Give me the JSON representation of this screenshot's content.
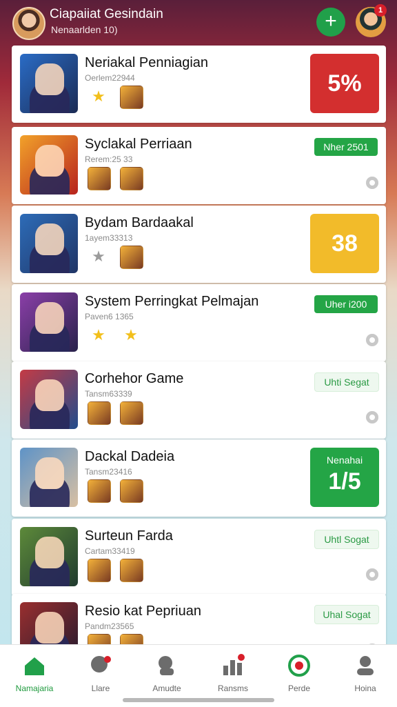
{
  "header": {
    "title": "Ciapaiiat Gesindain",
    "subtitle": "Nenaarlden 10)",
    "profile_badge": "1",
    "accent": "#21a04a"
  },
  "cards": [
    {
      "name": "Neriakal Penniagian",
      "meta": "Oerlem22944",
      "icon1": "star-gold",
      "icon2": "game-thumb",
      "right_type": "big",
      "right_value": "5%",
      "right_label": "",
      "right_color": "red",
      "c1": "#2a6cc6",
      "c2": "#1b2b54"
    },
    {
      "name": "Syclakal Perriaan",
      "meta": "Rerem:25 33",
      "icon1": "game-thumb",
      "icon2": "game-thumb",
      "right_type": "pill",
      "right_value": "Nher 2501",
      "right_label": "",
      "right_color": "green-solid",
      "c1": "#f2a22a",
      "c2": "#b7231d"
    },
    {
      "name": "Bydam Bardaakal",
      "meta": "1ayem33313",
      "icon1": "star-grey",
      "icon2": "game-thumb",
      "right_type": "big",
      "right_value": "38",
      "right_label": "",
      "right_color": "yellow",
      "c1": "#2d6cb8",
      "c2": "#203566"
    },
    {
      "name": "System Perringkat Pelmajan",
      "meta": "Paven6 1365",
      "icon1": "star-gold",
      "icon2": "star-gold",
      "right_type": "pill",
      "right_value": "Uher i200",
      "right_label": "",
      "right_color": "green-solid",
      "c1": "#8b3fa8",
      "c2": "#29224b"
    },
    {
      "name": "Corhehor Game",
      "meta": "Tansm63339",
      "icon1": "game-thumb",
      "icon2": "game-thumb",
      "right_type": "pill",
      "right_value": "Uhti Segat",
      "right_label": "",
      "right_color": "green-soft",
      "c1": "#c43b45",
      "c2": "#214c8c"
    },
    {
      "name": "Dackal Dadeia",
      "meta": "Tansm23416",
      "icon1": "game-thumb",
      "icon2": "game-thumb",
      "right_type": "big",
      "right_value": "1/5",
      "right_label": "Nenahai",
      "right_color": "green",
      "c1": "#5e93c7",
      "c2": "#d8c0a3"
    },
    {
      "name": "Surteun Farda",
      "meta": "Cartam33419",
      "icon1": "game-thumb",
      "icon2": "game-thumb",
      "right_type": "pill",
      "right_value": "Uhtl Sogat",
      "right_label": "",
      "right_color": "green-soft",
      "c1": "#5d8a3a",
      "c2": "#203b2f"
    },
    {
      "name": "Resio kat Pepriuan",
      "meta": "Pandm23565",
      "icon1": "game-thumb",
      "icon2": "game-thumb",
      "right_type": "pill",
      "right_value": "Uhal Sogat",
      "right_label": "",
      "right_color": "green-soft",
      "c1": "#9a2f2f",
      "c2": "#241a2e"
    }
  ],
  "nav": [
    {
      "label": "Namajaria",
      "icon": "home-icon",
      "active": true
    },
    {
      "label": "Llare",
      "icon": "chat-icon",
      "active": false
    },
    {
      "label": "Amudte",
      "icon": "profile-bubble-icon",
      "active": false
    },
    {
      "label": "Ransms",
      "icon": "bar-chart-icon",
      "active": false
    },
    {
      "label": "Perde",
      "icon": "target-icon",
      "active": false
    },
    {
      "label": "Hoina",
      "icon": "user-icon",
      "active": false
    }
  ]
}
